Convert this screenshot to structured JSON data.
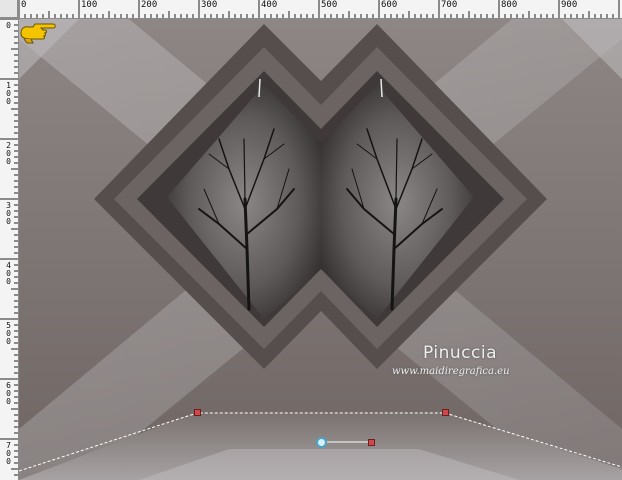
{
  "ruler": {
    "horizontal_labels": [
      "0",
      "100",
      "200",
      "300",
      "400",
      "500",
      "600",
      "700",
      "800",
      "900"
    ],
    "vertical_labels": [
      "0",
      "100",
      "200",
      "300",
      "400",
      "500",
      "600",
      "700"
    ]
  },
  "canvas": {
    "watermark": {
      "name": "Pinuccia",
      "url": "www.maidiregrafica.eu"
    }
  },
  "colors": {
    "background_gray": "#8c8582",
    "pale_gray": "#b4b0b2",
    "dark_taupe": "#5f5654",
    "handle_red": "#d04848",
    "rotation_handle_blue": "#4aa2c8",
    "cursor_yellow": "#f4c400"
  },
  "icons": {
    "cursor": "pointing-hand-icon"
  }
}
